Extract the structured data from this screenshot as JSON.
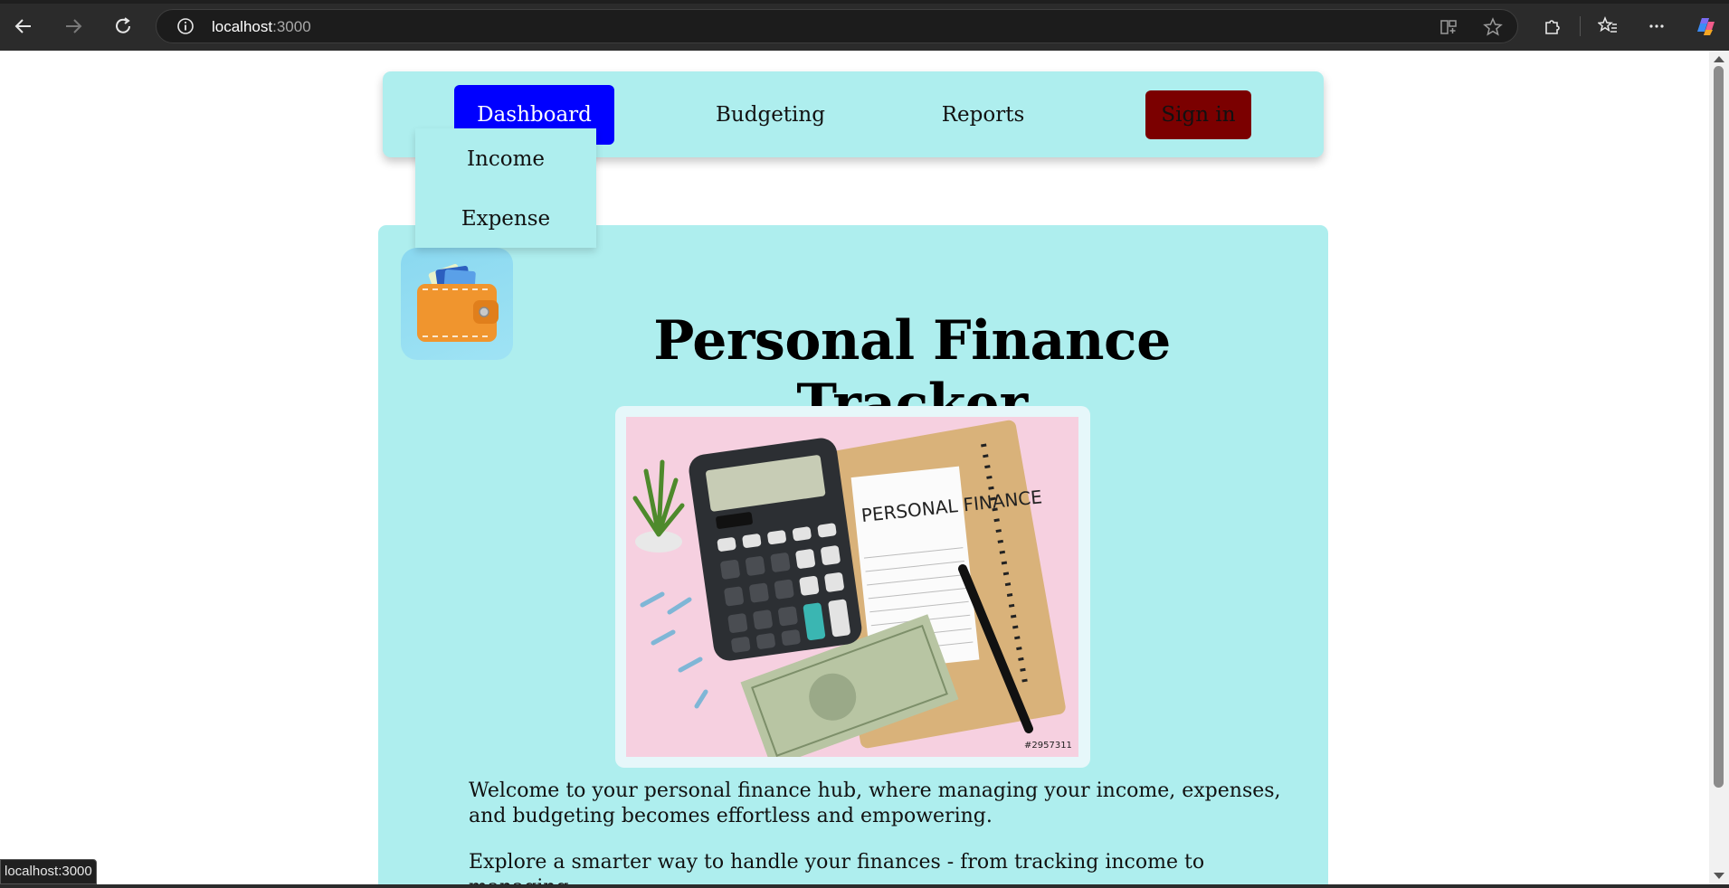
{
  "browser": {
    "url_host": "localhost",
    "url_port": ":3000"
  },
  "nav": {
    "items": [
      {
        "label": "Dashboard"
      },
      {
        "label": "Budgeting"
      },
      {
        "label": "Reports"
      }
    ],
    "signin_label": "Sign in",
    "dropdown": [
      {
        "label": "Income"
      },
      {
        "label": "Expense"
      }
    ]
  },
  "main": {
    "title": "Personal Finance Tracker",
    "hero_note_text": "PERSONAL FINANCE",
    "hero_stock_id": "#2957311",
    "paragraphs": [
      "Welcome to your personal finance hub, where managing your income, expenses, and budgeting becomes effortless and empowering.",
      "Explore a smarter way to handle your finances - from tracking income to managing"
    ]
  },
  "status_bar": {
    "link_preview": "localhost:3000"
  },
  "colors": {
    "nav_bg": "#aeeeee",
    "active_tab": "#0000ff",
    "signin_bg": "#7b0000"
  }
}
